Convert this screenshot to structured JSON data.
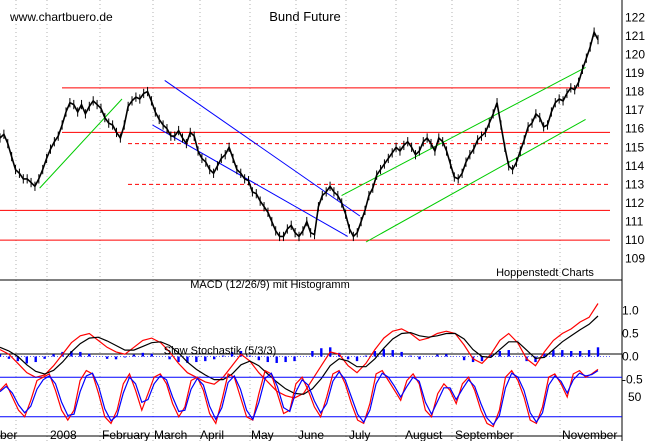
{
  "watermark": "www.chartbuero.de",
  "source_label": "Hoppenstedt Charts",
  "colors": {
    "price": "#000000",
    "red": "#ff0000",
    "blue": "#0000ff",
    "green": "#00cc00",
    "grid": "#808080",
    "macd_hist": "#0000ff",
    "stoch_k": "#ff0000",
    "stoch_d": "#0000ff"
  },
  "chart_data": [
    {
      "type": "line",
      "title": "Bund Future",
      "x_tick_labels": [
        "ber",
        "2008",
        "February",
        "March",
        "April",
        "May",
        "June",
        "July",
        "August",
        "September",
        "November"
      ],
      "y_ticks": [
        109,
        110,
        111,
        112,
        113,
        114,
        115,
        116,
        117,
        118,
        119,
        120,
        121,
        122
      ],
      "ylim": [
        108.5,
        122.5
      ],
      "grid": true,
      "series": [
        {
          "values": [
            115.5,
            115.7,
            115.2,
            114.5,
            113.8,
            113.6,
            113.3,
            113.3,
            113.1,
            112.9,
            113.3,
            113.8,
            114.4,
            114.9,
            115.3,
            115.6,
            116.2,
            116.9,
            117.4,
            117.3,
            116.9,
            117.3,
            116.8,
            117.2,
            117.5,
            117.3,
            117.1,
            116.6,
            116.3,
            116.2,
            115.8,
            115.5,
            116.2,
            117.2,
            117.5,
            117.7,
            117.6,
            117.9,
            118.0,
            117.5,
            116.9,
            116.5,
            116.2,
            116.0,
            115.6,
            115.6,
            115.9,
            115.5,
            115.2,
            115.8,
            115.6,
            114.8,
            114.4,
            114.2,
            113.8,
            113.6,
            114.0,
            114.4,
            114.6,
            115.0,
            114.4,
            113.8,
            113.6,
            113.3,
            113.2,
            112.6,
            112.5,
            112.1,
            111.8,
            111.5,
            111.0,
            110.5,
            110.2,
            110.2,
            110.6,
            110.8,
            110.4,
            110.2,
            110.5,
            111.0,
            110.4,
            110.3,
            111.8,
            112.4,
            112.6,
            112.9,
            112.6,
            112.4,
            112.0,
            111.4,
            110.6,
            110.2,
            110.4,
            111.0,
            111.6,
            112.4,
            112.8,
            113.5,
            113.8,
            114.1,
            114.4,
            114.7,
            115.0,
            114.8,
            115.1,
            115.3,
            115.0,
            114.6,
            114.8,
            115.3,
            115.5,
            115.2,
            114.8,
            115.5,
            115.3,
            114.8,
            114.1,
            113.4,
            113.3,
            113.6,
            114.2,
            114.6,
            114.9,
            115.4,
            115.6,
            115.8,
            116.3,
            116.8,
            117.4,
            116.2,
            115.0,
            114.0,
            113.8,
            114.2,
            114.8,
            115.4,
            116.1,
            116.3,
            116.8,
            116.6,
            116.1,
            116.2,
            116.9,
            117.4,
            117.6,
            117.5,
            117.9,
            118.2,
            118.1,
            118.5,
            119.2,
            119.8,
            120.4,
            121.2,
            120.8
          ],
          "line_width": 1.6
        }
      ],
      "horizontal_lines": [
        {
          "y": 118.2,
          "style": "solid",
          "color": "red"
        },
        {
          "y": 115.8,
          "style": "solid",
          "color": "red"
        },
        {
          "y": 115.2,
          "style": "dashed",
          "color": "red"
        },
        {
          "y": 113.0,
          "style": "dashed",
          "color": "red"
        },
        {
          "y": 111.6,
          "style": "solid",
          "color": "red"
        },
        {
          "y": 110.0,
          "style": "solid",
          "color": "red"
        }
      ],
      "trend_lines": [
        {
          "color": "blue",
          "from": [
            0.27,
            118.6
          ],
          "to": [
            0.59,
            111.3
          ]
        },
        {
          "color": "blue",
          "from": [
            0.25,
            116.2
          ],
          "to": [
            0.57,
            110.2
          ]
        },
        {
          "color": "green",
          "from": [
            0.065,
            112.8
          ],
          "to": [
            0.2,
            117.6
          ]
        },
        {
          "color": "green",
          "from": [
            0.56,
            112.4
          ],
          "to": [
            0.96,
            119.3
          ]
        },
        {
          "color": "green",
          "from": [
            0.6,
            109.9
          ],
          "to": [
            0.96,
            116.5
          ]
        }
      ]
    },
    {
      "type": "line",
      "title": "MACD (12/26/9) mit Histogramm",
      "y_ticks": [
        "1.0",
        "0.5",
        "0.0",
        "-0.5"
      ],
      "ylim": [
        -0.9,
        1.4
      ],
      "series": [
        {
          "values": [
            0.15,
            0.05,
            -0.15,
            -0.35,
            -0.45,
            -0.4,
            -0.2,
            0.05,
            0.3,
            0.45,
            0.5,
            0.35,
            0.2,
            0.1,
            0.05,
            0.2,
            0.35,
            0.4,
            0.3,
            0.1,
            -0.15,
            -0.35,
            -0.45,
            -0.55,
            -0.6,
            -0.45,
            -0.2,
            0.05,
            -0.1,
            -0.35,
            -0.55,
            -0.75,
            -0.85,
            -0.9,
            -0.8,
            -0.5,
            -0.2,
            0.1,
            0.05,
            -0.2,
            -0.35,
            -0.15,
            0.15,
            0.4,
            0.55,
            0.6,
            0.5,
            0.35,
            0.4,
            0.5,
            0.55,
            0.5,
            0.25,
            -0.05,
            -0.15,
            0.05,
            0.35,
            0.5,
            0.3,
            -0.05,
            -0.2,
            0.1,
            0.35,
            0.5,
            0.6,
            0.75,
            0.85,
            1.15
          ]
        },
        {
          "values": [
            0.2,
            0.12,
            0.0,
            -0.18,
            -0.32,
            -0.38,
            -0.3,
            -0.12,
            0.1,
            0.28,
            0.4,
            0.42,
            0.34,
            0.24,
            0.14,
            0.14,
            0.22,
            0.3,
            0.32,
            0.24,
            0.08,
            -0.12,
            -0.28,
            -0.4,
            -0.5,
            -0.5,
            -0.38,
            -0.18,
            -0.1,
            -0.2,
            -0.38,
            -0.55,
            -0.7,
            -0.8,
            -0.82,
            -0.7,
            -0.48,
            -0.2,
            -0.05,
            -0.1,
            -0.22,
            -0.22,
            -0.05,
            0.18,
            0.38,
            0.5,
            0.52,
            0.45,
            0.42,
            0.45,
            0.5,
            0.5,
            0.38,
            0.15,
            0.0,
            -0.02,
            0.15,
            0.32,
            0.32,
            0.14,
            -0.04,
            -0.02,
            0.15,
            0.32,
            0.45,
            0.58,
            0.7,
            0.88
          ]
        },
        {
          "values": [
            0.05,
            -0.05,
            -0.1,
            -0.15,
            -0.12,
            -0.05,
            0.05,
            0.1,
            0.12,
            0.1,
            0.06,
            0.0,
            -0.05,
            -0.06,
            -0.02,
            0.04,
            0.08,
            0.06,
            0.0,
            -0.06,
            -0.12,
            -0.14,
            -0.12,
            -0.1,
            -0.06,
            0.02,
            0.1,
            0.12,
            0.02,
            -0.08,
            -0.12,
            -0.14,
            -0.12,
            -0.1,
            0.0,
            0.12,
            0.18,
            0.2,
            0.08,
            -0.06,
            -0.1,
            0.02,
            0.12,
            0.16,
            0.14,
            0.1,
            0.02,
            -0.06,
            0.0,
            0.04,
            0.05,
            0.0,
            -0.08,
            -0.12,
            -0.1,
            0.04,
            0.12,
            0.14,
            0.0,
            -0.1,
            -0.12,
            0.06,
            0.14,
            0.14,
            0.12,
            0.12,
            0.14,
            0.2
          ]
        }
      ]
    },
    {
      "type": "line",
      "title": "Slow Stochastik (5/3/3)",
      "y_ticks": [
        "50"
      ],
      "ylim": [
        0,
        100
      ],
      "horizontal_lines": [
        {
          "y": 80,
          "color": "blue"
        },
        {
          "y": 20,
          "color": "blue"
        }
      ],
      "series": [
        {
          "values": [
            60,
            70,
            50,
            30,
            20,
            45,
            75,
            80,
            85,
            60,
            30,
            15,
            30,
            75,
            90,
            85,
            55,
            20,
            10,
            30,
            70,
            85,
            60,
            30,
            55,
            80,
            85,
            70,
            40,
            20,
            35,
            75,
            80,
            60,
            25,
            10,
            45,
            85,
            80,
            50,
            20,
            15,
            55,
            90,
            85,
            55,
            25,
            30,
            70,
            80,
            60,
            35,
            20,
            50,
            85,
            90,
            70,
            40,
            15,
            10,
            40,
            85,
            90,
            75,
            60,
            45,
            75,
            85,
            70,
            30,
            20,
            55,
            70,
            60,
            40,
            70,
            80,
            60,
            30,
            10,
            5,
            30,
            80,
            90,
            75,
            50,
            15,
            10,
            35,
            80,
            85,
            70,
            50,
            85,
            90,
            80,
            85,
            92
          ]
        },
        {
          "values": [
            58,
            66,
            56,
            38,
            26,
            36,
            62,
            76,
            82,
            70,
            42,
            22,
            24,
            58,
            82,
            86,
            66,
            32,
            14,
            22,
            56,
            80,
            70,
            42,
            46,
            70,
            82,
            76,
            50,
            28,
            30,
            62,
            78,
            68,
            36,
            16,
            34,
            72,
            82,
            62,
            30,
            16,
            42,
            78,
            86,
            66,
            34,
            28,
            58,
            76,
            68,
            44,
            26,
            40,
            74,
            88,
            76,
            50,
            24,
            12,
            30,
            70,
            86,
            80,
            66,
            50,
            66,
            80,
            74,
            42,
            24,
            44,
            64,
            64,
            46,
            62,
            76,
            66,
            40,
            18,
            8,
            22,
            64,
            86,
            80,
            60,
            26,
            12,
            26,
            68,
            82,
            74,
            56,
            76,
            86,
            82,
            84,
            90
          ]
        }
      ]
    }
  ]
}
